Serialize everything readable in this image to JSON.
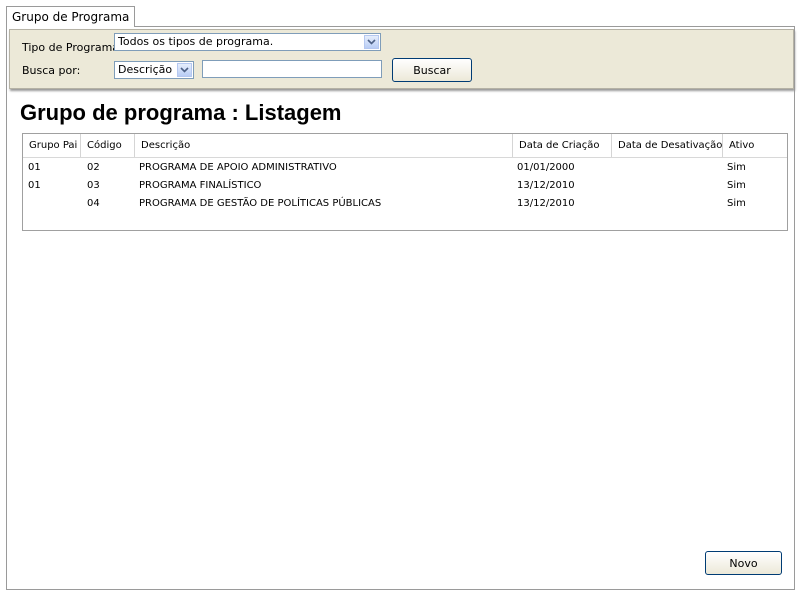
{
  "tab": {
    "label": "Grupo de Programa"
  },
  "filter": {
    "tipo_label": "Tipo de Programa:",
    "tipo_value": "Todos os tipos de programa.",
    "busca_label": "Busca por:",
    "busca_field": "Descrição",
    "search_value": "",
    "search_button": "Buscar"
  },
  "page_title": "Grupo de programa : Listagem",
  "table": {
    "columns": [
      "Grupo Pai",
      "Código",
      "Descrição",
      "Data de Criação",
      "Data de Desativação",
      "Ativo"
    ],
    "rows": [
      [
        "01",
        "02",
        "PROGRAMA DE APOIO ADMINISTRATIVO",
        "01/01/2000",
        "",
        "Sim"
      ],
      [
        "01",
        "03",
        "PROGRAMA FINALÍSTICO",
        "13/12/2010",
        "",
        "Sim"
      ],
      [
        "",
        "04",
        "PROGRAMA DE GESTÃO DE POLÍTICAS PÚBLICAS",
        "13/12/2010",
        "",
        "Sim"
      ]
    ]
  },
  "footer": {
    "new_button": "Novo"
  },
  "icons": {
    "dropdown": "chevron-down-icon"
  },
  "colors": {
    "panel_bg": "#ece9d8",
    "border": "#9a9a9a",
    "input_border": "#7f9db9"
  }
}
